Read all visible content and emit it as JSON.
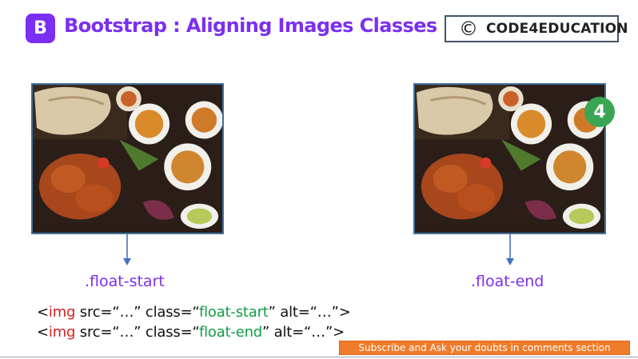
{
  "header": {
    "logo_letter": "B",
    "title": "Bootstrap : Aligning Images Classes",
    "brand_symbol": "©",
    "brand_name": "CODE4EDUCATION"
  },
  "images": {
    "left_label": ".float-start",
    "right_label": ".float-end",
    "watermark_text": "4"
  },
  "code": {
    "line1": {
      "open": "<",
      "tag": "img",
      "mid1": " src=“…” class=“",
      "value": "float-start",
      "mid2": "” alt=“…”>"
    },
    "line2": {
      "open": "<",
      "tag": "img",
      "mid1": " src=“…” class=“",
      "value": "float-end",
      "mid2": "” alt=“…”>"
    }
  },
  "footer": {
    "subscribe_text": "Subscribe and Ask your doubts in comments section"
  },
  "colors": {
    "accent": "#7b2ff2",
    "tag": "#d32020",
    "value": "#119d48",
    "frame": "#41719c",
    "banner": "#ee7c2a"
  },
  "icons": [
    "bootstrap-logo-icon",
    "copyright-icon",
    "arrow-down-icon",
    "watermark-icon"
  ]
}
